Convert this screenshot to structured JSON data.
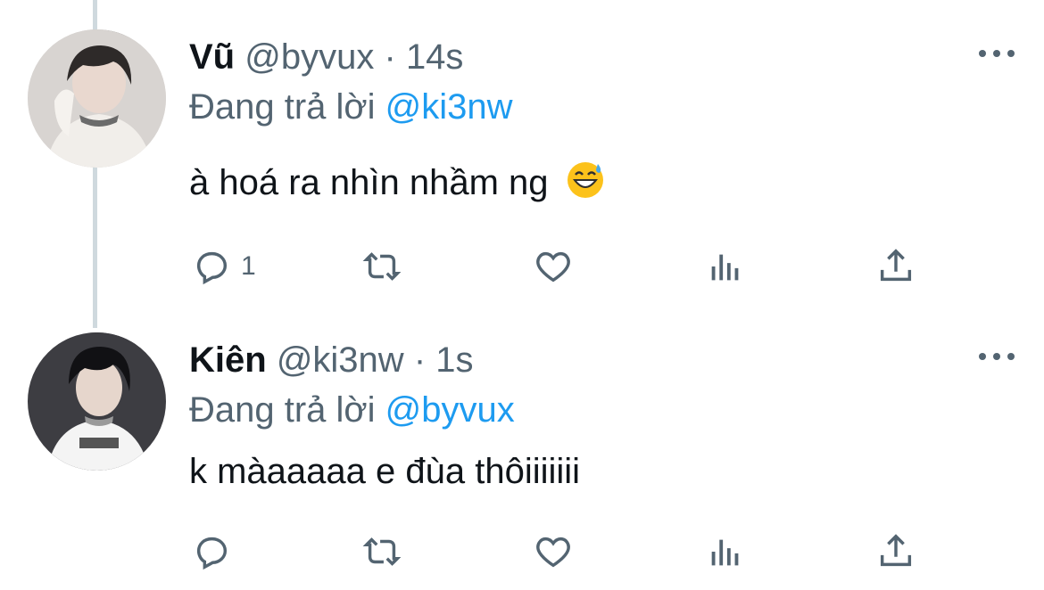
{
  "tweets": [
    {
      "name": "Vũ",
      "handle": "@byvux",
      "separator": "·",
      "time": "14s",
      "replying_prefix": "Đang trả lời",
      "replying_to": "@ki3nw",
      "text": "à hoá ra nhìn nhầm ng",
      "emoji": "grinning-face-with-sweat",
      "reply_count": "1"
    },
    {
      "name": "Kiên",
      "handle": "@ki3nw",
      "separator": "·",
      "time": "1s",
      "replying_prefix": "Đang trả lời",
      "replying_to": "@byvux",
      "text": "k màaaaaa e đùa thôiiiiiii",
      "reply_count": ""
    }
  ],
  "colors": {
    "text": "#0f1419",
    "secondary": "#536471",
    "link": "#1d9bf0",
    "thread_line": "#cfd9de"
  },
  "icons": [
    "reply-icon",
    "retweet-icon",
    "like-icon",
    "views-icon",
    "share-icon",
    "more-icon"
  ]
}
